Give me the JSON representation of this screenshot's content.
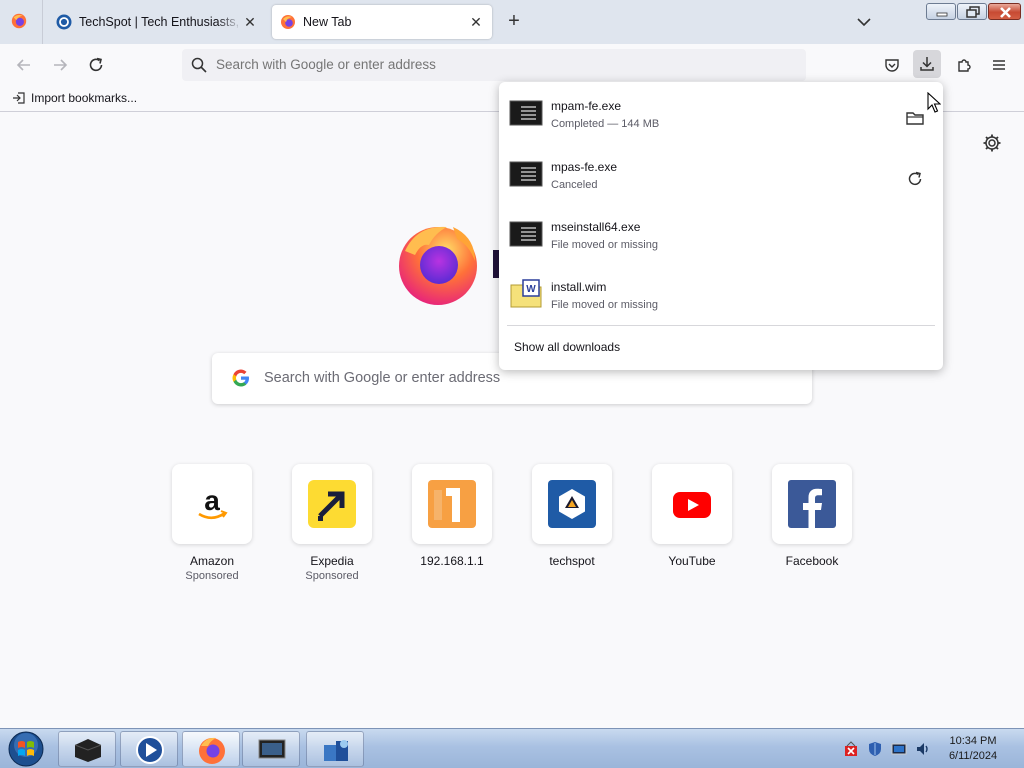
{
  "tabs": [
    {
      "title": "TechSpot | Tech Enthusiasts, Power Users, Gamers",
      "active": false
    },
    {
      "title": "New Tab",
      "active": true
    }
  ],
  "urlbar": {
    "placeholder": "Search with Google or enter address"
  },
  "bookmarks": {
    "import_label": "Import bookmarks..."
  },
  "newtab": {
    "search_placeholder": "Search with Google or enter address",
    "tiles": [
      {
        "label": "Amazon",
        "sub": "Sponsored",
        "icon": "amazon-logo-icon"
      },
      {
        "label": "Expedia",
        "sub": "Sponsored",
        "icon": "expedia-logo-icon"
      },
      {
        "label": "192.168.1.1",
        "sub": "",
        "icon": "router-logo-icon"
      },
      {
        "label": "techspot",
        "sub": "",
        "icon": "techspot-logo-icon"
      },
      {
        "label": "YouTube",
        "sub": "",
        "icon": "youtube-logo-icon"
      },
      {
        "label": "Facebook",
        "sub": "",
        "icon": "facebook-logo-icon"
      }
    ]
  },
  "downloads": {
    "items": [
      {
        "name": "mpam-fe.exe",
        "status": "Completed — 144 MB",
        "action": "folder-icon"
      },
      {
        "name": "mpas-fe.exe",
        "status": "Canceled",
        "action": "retry-icon"
      },
      {
        "name": "mseinstall64.exe",
        "status": "File moved or missing",
        "action": ""
      },
      {
        "name": "install.wim",
        "status": "File moved or missing",
        "action": ""
      }
    ],
    "show_all": "Show all downloads"
  },
  "taskbar": {
    "time": "10:34 PM",
    "date": "6/11/2024"
  },
  "colors": {
    "accent": "#0060df",
    "tabstrip": "#dfe5ee",
    "youtube_red": "#ff0000",
    "facebook_blue": "#3b5998",
    "techspot_blue": "#1f5ba6"
  }
}
